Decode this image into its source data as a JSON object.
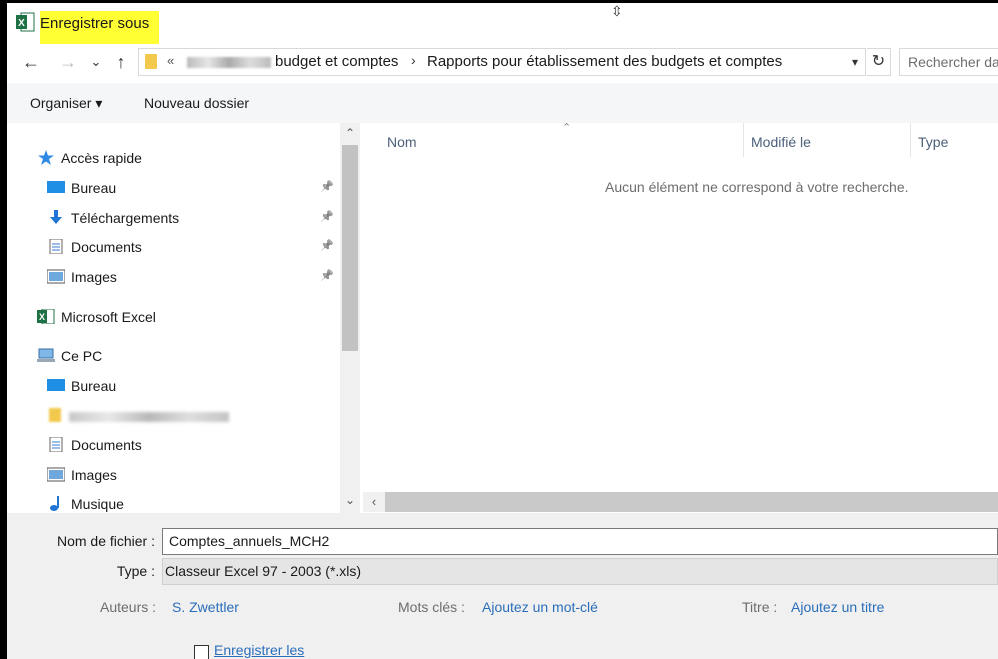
{
  "window": {
    "title": "Enregistrer sous"
  },
  "address": {
    "prefix": "«",
    "segments": [
      "budget et comptes",
      "Rapports pour établissement des budgets et comptes"
    ],
    "separator": "›"
  },
  "search": {
    "placeholder": "Rechercher dans"
  },
  "commands": {
    "organize": "Organiser ▾",
    "new_folder": "Nouveau dossier"
  },
  "nav": {
    "quick_access": "Accès rapide",
    "quick_items": [
      "Bureau",
      "Téléchargements",
      "Documents",
      "Images"
    ],
    "excel": "Microsoft Excel",
    "this_pc": "Ce PC",
    "pc_items": [
      "Bureau",
      "Documents",
      "Images",
      "Musique"
    ]
  },
  "columns": {
    "name": "Nom",
    "modified": "Modifié le",
    "type": "Type"
  },
  "empty_message": "Aucun élément ne correspond à votre recherche.",
  "form": {
    "filename_label": "Nom de fichier :",
    "filename_value": "Comptes_annuels_MCH2",
    "type_label": "Type :",
    "type_value": "Classeur Excel 97 - 2003 (*.xls)",
    "authors_label": "Auteurs :",
    "authors_value": "S. Zwettler",
    "keywords_label": "Mots clés :",
    "keywords_value": "Ajoutez un mot-clé",
    "title_label": "Titre :",
    "title_value": "Ajoutez un titre",
    "save_thumb_label": "Enregistrer les"
  },
  "icons": {
    "back": "←",
    "forward": "→",
    "recent": "⌄",
    "up": "↑",
    "refresh": "↻",
    "pin": "📌",
    "scroll_up": "⌃",
    "scroll_down": "⌄",
    "scroll_left": "‹",
    "sort": "⌃"
  },
  "colors": {
    "excel_green": "#1e7145",
    "title_highlight": "#ffff33",
    "link_blue": "#2a6ebb"
  }
}
